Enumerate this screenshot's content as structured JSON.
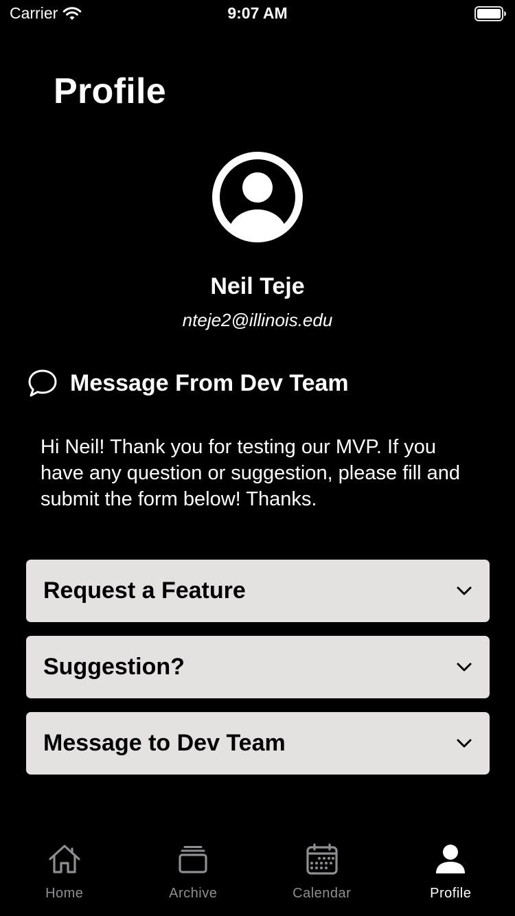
{
  "status_bar": {
    "carrier": "Carrier",
    "time": "9:07 AM"
  },
  "page": {
    "title": "Profile"
  },
  "user": {
    "name": "Neil Teje",
    "email": "nteje2@illinois.edu"
  },
  "message": {
    "header": "Message From Dev Team",
    "body": "Hi Neil! Thank you for testing our MVP. If you have any question or suggestion, please fill and submit the form below! Thanks."
  },
  "accordions": [
    {
      "label": "Request a Feature",
      "icon": "chevron-down-icon"
    },
    {
      "label": "Suggestion?",
      "icon": "chevron-down-icon"
    },
    {
      "label": "Message to Dev Team",
      "icon": "chevron-down-icon"
    }
  ],
  "tab_bar": {
    "active": "Profile",
    "tabs": [
      {
        "label": "Home",
        "icon": "home-icon"
      },
      {
        "label": "Archive",
        "icon": "archive-icon"
      },
      {
        "label": "Calendar",
        "icon": "calendar-icon"
      },
      {
        "label": "Profile",
        "icon": "person-icon"
      }
    ]
  },
  "colors": {
    "background": "#000000",
    "card": "#e4e1e0",
    "tab_inactive": "#8e8e93",
    "tab_active": "#ffffff"
  }
}
